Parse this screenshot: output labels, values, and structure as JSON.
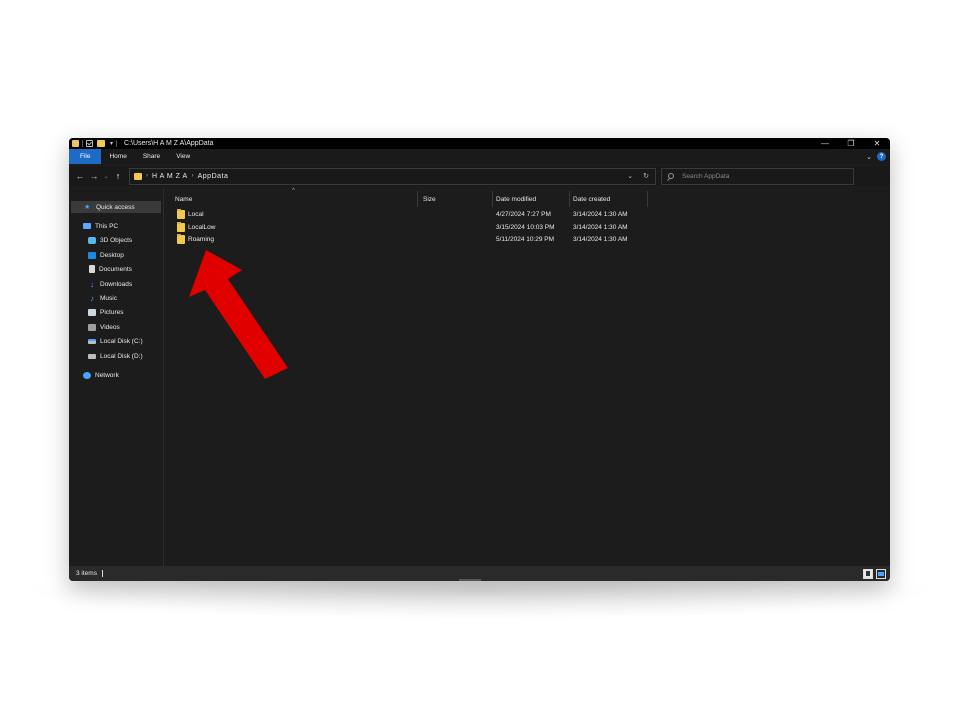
{
  "window": {
    "title_path": "C:\\Users\\H A M Z A\\AppData",
    "minimize_glyph": "—",
    "maximize_glyph": "❐",
    "close_glyph": "✕"
  },
  "ribbon": {
    "tabs": [
      "File",
      "Home",
      "Share",
      "View"
    ],
    "expand_glyph": "⌄",
    "help_glyph": "?"
  },
  "navigation": {
    "back_glyph": "←",
    "forward_glyph": "→",
    "recent_glyph": "⌄",
    "up_glyph": "↑"
  },
  "address": {
    "parts": [
      "H A M Z A",
      "AppData"
    ],
    "separator": "›",
    "dropdown_glyph": "⌄",
    "refresh_glyph": "↻"
  },
  "search": {
    "placeholder": "Search AppData"
  },
  "sidebar": {
    "items": [
      {
        "label": "Quick access",
        "icon": "star-icon"
      },
      {
        "label": "This PC",
        "icon": "pc-icon"
      },
      {
        "label": "3D Objects",
        "icon": "3d-objects-icon"
      },
      {
        "label": "Desktop",
        "icon": "desktop-icon"
      },
      {
        "label": "Documents",
        "icon": "documents-icon"
      },
      {
        "label": "Downloads",
        "icon": "download-arrow-icon"
      },
      {
        "label": "Music",
        "icon": "music-note-icon"
      },
      {
        "label": "Pictures",
        "icon": "pictures-icon"
      },
      {
        "label": "Videos",
        "icon": "videos-icon"
      },
      {
        "label": "Local Disk (C:)",
        "icon": "windows-drive-icon"
      },
      {
        "label": "Local Disk (D:)",
        "icon": "drive-icon"
      },
      {
        "label": "Network",
        "icon": "network-icon"
      }
    ]
  },
  "file_list": {
    "columns": [
      "Name",
      "Size",
      "Date modified",
      "Date created"
    ],
    "sort_glyph": "^",
    "rows": [
      {
        "name": "Local",
        "size": "",
        "date_modified": "4/27/2024 7:27 PM",
        "date_created": "3/14/2024 1:30 AM"
      },
      {
        "name": "LocalLow",
        "size": "",
        "date_modified": "3/15/2024 10:03 PM",
        "date_created": "3/14/2024 1:30 AM"
      },
      {
        "name": "Roaming",
        "size": "",
        "date_modified": "5/11/2024 10:29 PM",
        "date_created": "3/14/2024 1:30 AM"
      }
    ]
  },
  "status_bar": {
    "item_count": "3 items"
  },
  "colors": {
    "accent": "#1e6ac7",
    "folder": "#f2c94c",
    "annotation_arrow": "#e00000",
    "window_bg": "#1c1c1c"
  }
}
